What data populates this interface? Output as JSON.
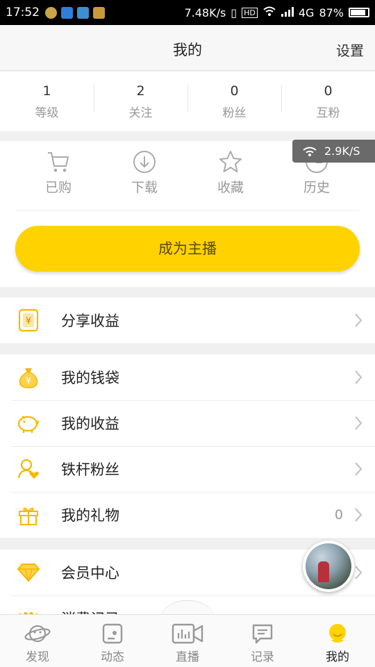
{
  "status_bar": {
    "time": "17:52",
    "speed": "7.48K/s",
    "network": "4G",
    "battery": "87%",
    "battery_level": 0.87
  },
  "header": {
    "title": "我的",
    "settings_label": "设置"
  },
  "stats": [
    {
      "value": "1",
      "label": "等级"
    },
    {
      "value": "2",
      "label": "关注"
    },
    {
      "value": "0",
      "label": "粉丝"
    },
    {
      "value": "0",
      "label": "互粉"
    }
  ],
  "quick_actions": [
    {
      "label": "已购",
      "icon": "cart-icon"
    },
    {
      "label": "下载",
      "icon": "download-icon"
    },
    {
      "label": "收藏",
      "icon": "star-icon"
    },
    {
      "label": "历史",
      "icon": "clock-icon"
    }
  ],
  "net_badge": "2.9K/S",
  "become_anchor_label": "成为主播",
  "menu": {
    "share_earnings": {
      "label": "分享收益",
      "icon": "share-earnings-icon"
    },
    "wallet": {
      "label": "我的钱袋",
      "icon": "money-bag-icon"
    },
    "earnings": {
      "label": "我的收益",
      "icon": "piggy-bank-icon"
    },
    "fans": {
      "label": "铁杆粉丝",
      "icon": "fan-heart-icon"
    },
    "gifts": {
      "label": "我的礼物",
      "icon": "gift-icon",
      "value": "0"
    },
    "vip": {
      "label": "会员中心",
      "icon": "diamond-icon"
    },
    "records": {
      "label": "消费记录",
      "icon": "dots-icon"
    }
  },
  "tabs": [
    {
      "label": "发现",
      "icon": "planet-icon"
    },
    {
      "label": "动态",
      "icon": "feed-icon"
    },
    {
      "label": "直播",
      "icon": "live-camera-icon"
    },
    {
      "label": "记录",
      "icon": "message-icon"
    },
    {
      "label": "我的",
      "icon": "profile-icon",
      "active": true
    }
  ],
  "colors": {
    "accent": "#ffd200",
    "icon_gold": "#f5b800",
    "text_muted": "#999999"
  }
}
